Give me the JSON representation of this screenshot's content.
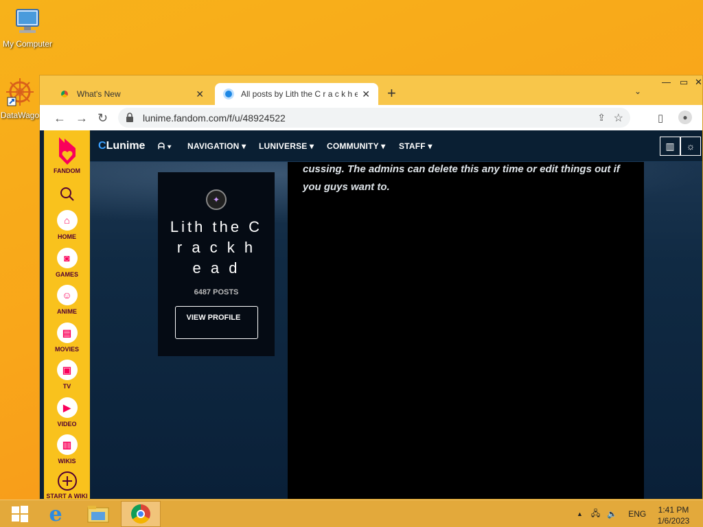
{
  "desktop": {
    "icons": [
      {
        "label": "My Computer"
      },
      {
        "label": "DataWago"
      }
    ]
  },
  "browser": {
    "tabs": [
      {
        "title": "What's New"
      },
      {
        "title": "All posts by Lith the C r a c k h e"
      }
    ],
    "new_tab": "+",
    "url": "lunime.fandom.com/f/u/48924522"
  },
  "fandom_sidebar": {
    "brand": "FANDOM",
    "items": [
      {
        "label": "HOME"
      },
      {
        "label": "GAMES"
      },
      {
        "label": "ANIME"
      },
      {
        "label": "MOVIES"
      },
      {
        "label": "TV"
      },
      {
        "label": "VIDEO"
      },
      {
        "label": "WIKIS"
      },
      {
        "label": "START A WIKI"
      }
    ]
  },
  "community_header": {
    "logo": "Lunime",
    "nav": [
      {
        "label": "NAVIGATION"
      },
      {
        "label": "LUNIVERSE"
      },
      {
        "label": "COMMUNITY"
      },
      {
        "label": "STAFF"
      }
    ]
  },
  "profile": {
    "name": "Lith the C r a c k h e a d",
    "posts": "6487 POSTS",
    "view_profile": "VIEW PROFILE"
  },
  "feed": {
    "text": "cussing. The admins can delete this any time or edit things out if you guys want to."
  },
  "taskbar": {
    "language": "ENG",
    "time": "1:41 PM",
    "date": "1/6/2023"
  },
  "colors": {
    "desktop_bg": "#f7a91a",
    "fandom_pink": "#fa005a",
    "fandom_yellow": "#f9c21d",
    "header_bg": "#0a1f33"
  }
}
